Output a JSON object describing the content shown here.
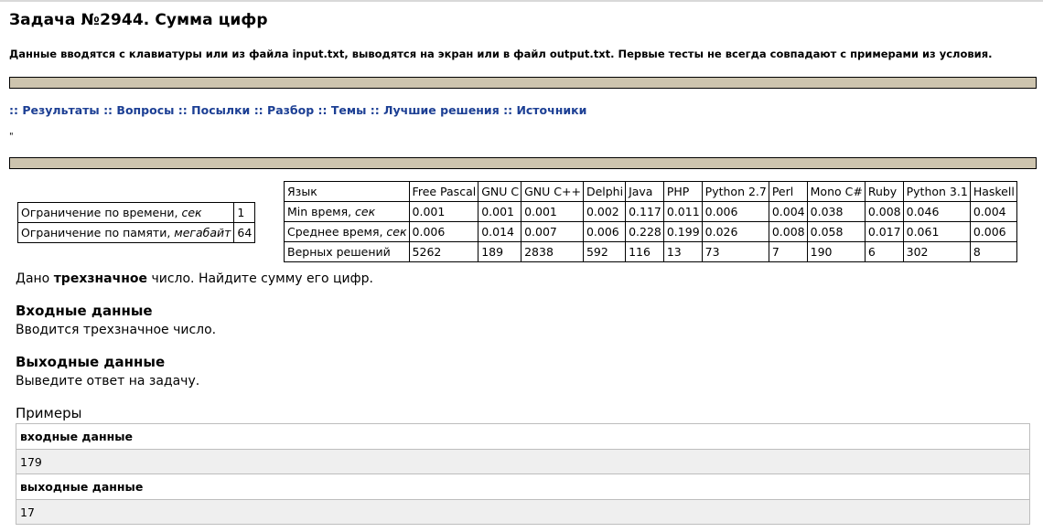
{
  "page": {
    "title": "Задача №2944. Сумма цифр",
    "intro": "Данные вводятся с клавиатуры или из файла input.txt, выводятся на экран или в файл output.txt. Первые тесты не всегда совпадают с примерами из условия.",
    "tiny_mark": "\""
  },
  "nav": {
    "items": [
      "Результаты",
      "Вопросы",
      "Посылки",
      "Разбор",
      "Темы",
      "Лучшие решения",
      "Источники"
    ],
    "separator": "::"
  },
  "limits": {
    "time_label": "Ограничение по времени, ",
    "time_unit": "сек",
    "time_value": "1",
    "memory_label": "Ограничение по памяти, ",
    "memory_unit": "мегабайт",
    "memory_value": "64"
  },
  "stats": {
    "header": [
      "Язык",
      "Free Pascal",
      "GNU C",
      "GNU C++",
      "Delphi",
      "Java",
      "PHP",
      "Python 2.7",
      "Perl",
      "Mono C#",
      "Ruby",
      "Python 3.1",
      "Haskell"
    ],
    "min_label": "Min время, ",
    "min_unit": "сек",
    "min": [
      "0.001",
      "0.001",
      "0.001",
      "0.002",
      "0.117",
      "0.011",
      "0.006",
      "0.004",
      "0.038",
      "0.008",
      "0.046",
      "0.004"
    ],
    "avg_label": "Среднее время, ",
    "avg_unit": "сек",
    "avg": [
      "0.006",
      "0.014",
      "0.007",
      "0.006",
      "0.228",
      "0.199",
      "0.026",
      "0.008",
      "0.058",
      "0.017",
      "0.061",
      "0.006"
    ],
    "correct_label": "Верных решений",
    "correct": [
      "5262",
      "189",
      "2838",
      "592",
      "116",
      "13",
      "73",
      "7",
      "190",
      "6",
      "302",
      "8"
    ]
  },
  "statement": {
    "pre": "Дано ",
    "bold": "трехзначное",
    "post": " число. Найдите сумму его цифр.",
    "input_title": "Входные данные",
    "input_text": "Вводится трехзначное число.",
    "output_title": "Выходные данные",
    "output_text": "Выведите ответ на задачу.",
    "examples_title": "Примеры"
  },
  "example": {
    "input_label": "входные данные",
    "input_value": "179",
    "output_label": "выходные данные",
    "output_value": "17"
  },
  "colors": {
    "bar": "#cdc4ae",
    "link": "#1c3f94",
    "example_bg": "#efefef"
  }
}
